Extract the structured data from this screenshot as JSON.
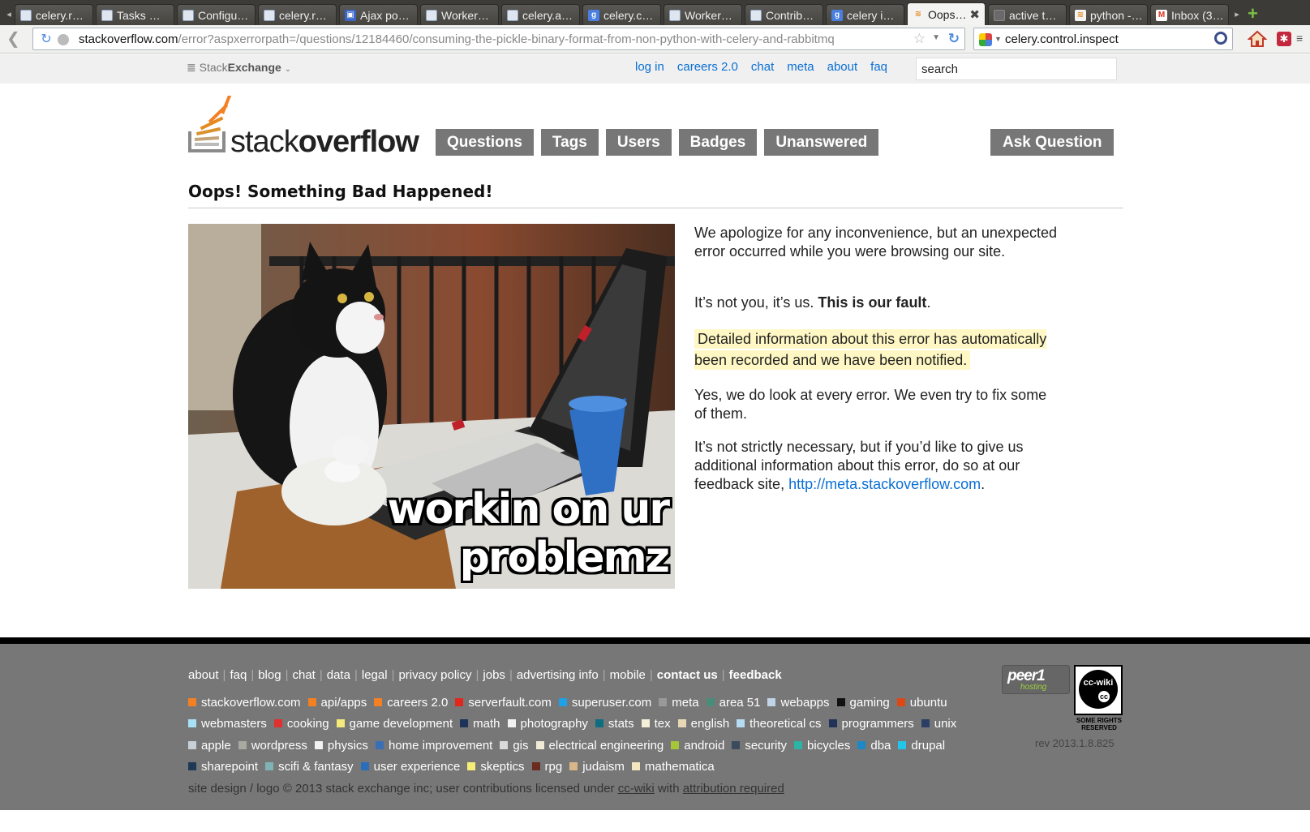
{
  "browser": {
    "tabs": [
      {
        "label": "celery.r…",
        "icon": "doc"
      },
      {
        "label": "Tasks …",
        "icon": "doc"
      },
      {
        "label": "Configu…",
        "icon": "doc"
      },
      {
        "label": "celery.r…",
        "icon": "doc"
      },
      {
        "label": "Ajax po…",
        "icon": "ajax"
      },
      {
        "label": "Worker…",
        "icon": "doc"
      },
      {
        "label": "celery.a…",
        "icon": "doc"
      },
      {
        "label": "celery.c…",
        "icon": "google"
      },
      {
        "label": "Worker…",
        "icon": "doc"
      },
      {
        "label": "Contrib…",
        "icon": "doc"
      },
      {
        "label": "celery i…",
        "icon": "google"
      },
      {
        "label": "Oops…",
        "icon": "so",
        "active": true
      },
      {
        "label": "active t…",
        "icon": "gen"
      },
      {
        "label": "python -…",
        "icon": "so"
      },
      {
        "label": "Inbox (3…",
        "icon": "mail"
      }
    ],
    "url_host": "stackoverflow.com",
    "url_path": "/error?aspxerrorpath=/questions/12184460/consuming-the-pickle-binary-format-from-non-python-with-celery-and-rabbitmq",
    "search_value": "celery.control.inspect"
  },
  "sebar": {
    "brand_light": "Stack",
    "brand_bold": "Exchange",
    "links": [
      "log in",
      "careers 2.0",
      "chat",
      "meta",
      "about",
      "faq"
    ],
    "search_value": "search"
  },
  "header": {
    "logo_light": "stack",
    "logo_bold": "overflow",
    "nav": [
      "Questions",
      "Tags",
      "Users",
      "Badges",
      "Unanswered"
    ],
    "ask_label": "Ask Question"
  },
  "page": {
    "title": "Oops! Something Bad Happened!",
    "caption": "workin on ur problemz",
    "p1": "We apologize for any inconvenience, but an unexpected error occurred while you were browsing our site.",
    "p2_a": "It’s not you, it’s us. ",
    "p2_b": "This is our fault",
    "p2_c": ".",
    "p3": "Detailed information about this error has automatically been recorded and we have been notified.",
    "p4": "Yes, we do look at every error. We even try to fix some of them.",
    "p5": "It’s not strictly necessary, but if you’d like to give us additional information about this error, do so at our feedback site, ",
    "p5_link": "http://meta.stackoverflow.com",
    "p5_end": "."
  },
  "footer": {
    "links": [
      "about",
      "faq",
      "blog",
      "chat",
      "data",
      "legal",
      "privacy policy",
      "jobs",
      "advertising info",
      "mobile"
    ],
    "bold_links": [
      "contact us",
      "feedback"
    ],
    "sites": [
      {
        "name": "stackoverflow.com",
        "color": "#f48024"
      },
      {
        "name": "api/apps",
        "color": "#f48024"
      },
      {
        "name": "careers 2.0",
        "color": "#f48024"
      },
      {
        "name": "serverfault.com",
        "color": "#e1261c"
      },
      {
        "name": "superuser.com",
        "color": "#1ea1e6"
      },
      {
        "name": "meta",
        "color": "#999999"
      },
      {
        "name": "area 51",
        "color": "#4a8c7a"
      },
      {
        "name": "webapps",
        "color": "#bfd4e8"
      },
      {
        "name": "gaming",
        "color": "#111111"
      },
      {
        "name": "ubuntu",
        "color": "#dd4814"
      },
      {
        "name": "webmasters",
        "color": "#a8e0f5"
      },
      {
        "name": "cooking",
        "color": "#e03131"
      },
      {
        "name": "game development",
        "color": "#f5e97a"
      },
      {
        "name": "math",
        "color": "#1d3357"
      },
      {
        "name": "photography",
        "color": "#f2f2f2"
      },
      {
        "name": "stats",
        "color": "#0d6e80"
      },
      {
        "name": "tex",
        "color": "#f5efd8"
      },
      {
        "name": "english",
        "color": "#e8d7b5"
      },
      {
        "name": "theoretical cs",
        "color": "#b5dcf2"
      },
      {
        "name": "programmers",
        "color": "#22335a"
      },
      {
        "name": "unix",
        "color": "#2c3e65"
      },
      {
        "name": "apple",
        "color": "#c8cfd6"
      },
      {
        "name": "wordpress",
        "color": "#a9a9a0"
      },
      {
        "name": "physics",
        "color": "#f3f3f3"
      },
      {
        "name": "home improvement",
        "color": "#3a6fb5"
      },
      {
        "name": "gis",
        "color": "#dadada"
      },
      {
        "name": "electrical engineering",
        "color": "#f1ead7"
      },
      {
        "name": "android",
        "color": "#a4c639"
      },
      {
        "name": "security",
        "color": "#3a4b5c"
      },
      {
        "name": "bicycles",
        "color": "#2bb3a6"
      },
      {
        "name": "dba",
        "color": "#1e88c7"
      },
      {
        "name": "drupal",
        "color": "#23c5e8"
      },
      {
        "name": "sharepoint",
        "color": "#203858"
      },
      {
        "name": "scifi & fantasy",
        "color": "#7fb3b5"
      },
      {
        "name": "user experience",
        "color": "#2a6db8"
      },
      {
        "name": "skeptics",
        "color": "#f5ef78"
      },
      {
        "name": "rpg",
        "color": "#6b2b1e"
      },
      {
        "name": "judaism",
        "color": "#d9b58a"
      },
      {
        "name": "mathematica",
        "color": "#f5e8c0"
      }
    ],
    "copyright_a": "site design / logo © 2013 stack exchange inc; user contributions licensed under ",
    "copyright_link1": "cc-wiki",
    "copyright_b": " with ",
    "copyright_link2": "attribution required",
    "peer1_title": "peer1",
    "peer1_sub": "hosting",
    "ccwiki_label": "cc-wiki",
    "cc_mark": "cc",
    "cc_rights": "SOME RIGHTS RESERVED",
    "rev": "rev 2013.1.8.825"
  }
}
